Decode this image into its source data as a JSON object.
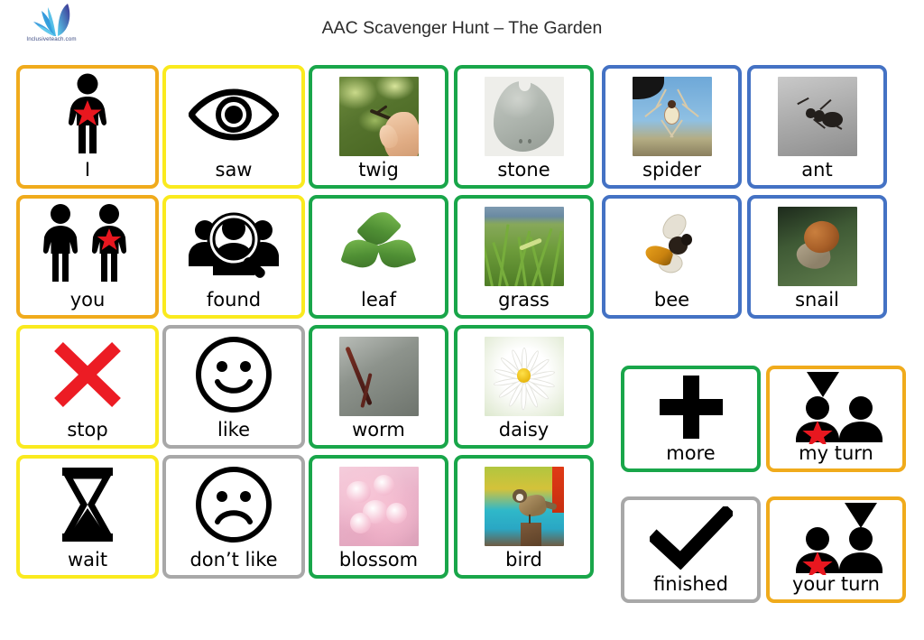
{
  "header": {
    "title": "AAC Scavenger Hunt – The Garden",
    "logo_text": "Inclusiveteach.com",
    "logo_name": "inclusiveteach-logo"
  },
  "colors": {
    "orange": "#F0AB1C",
    "yellow": "#FAEA1E",
    "green": "#19A64A",
    "blue": "#4472C4",
    "gray": "#A8A8A8",
    "star_red": "#E8171F",
    "stop_red": "#EC1C24",
    "background": "#FFFFFF",
    "title_text": "#2B2B2B"
  },
  "board": {
    "columns": 6,
    "rows": 4,
    "cards": [
      {
        "id": "i",
        "label": "I",
        "border": "orange",
        "art": "person-star-icon",
        "row": 1,
        "col": 1
      },
      {
        "id": "saw",
        "label": "saw",
        "border": "yellow",
        "art": "eye-icon",
        "row": 1,
        "col": 2
      },
      {
        "id": "twig",
        "label": "twig",
        "border": "green",
        "art": "twig-photo",
        "row": 1,
        "col": 3
      },
      {
        "id": "stone",
        "label": "stone",
        "border": "green",
        "art": "stone-photo",
        "row": 1,
        "col": 4
      },
      {
        "id": "spider",
        "label": "spider",
        "border": "blue",
        "art": "spider-photo",
        "row": 1,
        "col": 5
      },
      {
        "id": "ant",
        "label": "ant",
        "border": "blue",
        "art": "ant-photo",
        "row": 1,
        "col": 6
      },
      {
        "id": "you",
        "label": "you",
        "border": "orange",
        "art": "two-people-star-icon",
        "row": 2,
        "col": 1
      },
      {
        "id": "found",
        "label": "found",
        "border": "yellow",
        "art": "magnifier-people-icon",
        "row": 2,
        "col": 2
      },
      {
        "id": "leaf",
        "label": "leaf",
        "border": "green",
        "art": "leaf-photo",
        "row": 2,
        "col": 3
      },
      {
        "id": "grass",
        "label": "grass",
        "border": "green",
        "art": "grass-photo",
        "row": 2,
        "col": 4
      },
      {
        "id": "bee",
        "label": "bee",
        "border": "blue",
        "art": "bee-photo",
        "row": 2,
        "col": 5
      },
      {
        "id": "snail",
        "label": "snail",
        "border": "blue",
        "art": "snail-photo",
        "row": 2,
        "col": 6
      },
      {
        "id": "stop",
        "label": "stop",
        "border": "yellow",
        "art": "red-cross-icon",
        "row": 3,
        "col": 1
      },
      {
        "id": "like",
        "label": "like",
        "border": "gray",
        "art": "happy-face-icon",
        "row": 3,
        "col": 2
      },
      {
        "id": "worm",
        "label": "worm",
        "border": "green",
        "art": "worm-photo",
        "row": 3,
        "col": 3
      },
      {
        "id": "daisy",
        "label": "daisy",
        "border": "green",
        "art": "daisy-photo",
        "row": 3,
        "col": 4
      },
      {
        "id": "wait",
        "label": "wait",
        "border": "yellow",
        "art": "hourglass-icon",
        "row": 4,
        "col": 1
      },
      {
        "id": "dont-like",
        "label": "don’t like",
        "border": "gray",
        "art": "sad-face-icon",
        "row": 4,
        "col": 2
      },
      {
        "id": "blossom",
        "label": "blossom",
        "border": "green",
        "art": "blossom-photo",
        "row": 4,
        "col": 3
      },
      {
        "id": "bird",
        "label": "bird",
        "border": "green",
        "art": "bird-photo",
        "row": 4,
        "col": 4
      },
      {
        "id": "more",
        "label": "more",
        "border": "green",
        "art": "plus-icon",
        "row": 3,
        "col": 5
      },
      {
        "id": "my-turn",
        "label": "my turn",
        "border": "orange",
        "art": "my-turn-icon",
        "row": 3,
        "col": 6
      },
      {
        "id": "finished",
        "label": "finished",
        "border": "gray",
        "art": "checkmark-icon",
        "row": 4,
        "col": 5
      },
      {
        "id": "your-turn",
        "label": "your turn",
        "border": "orange",
        "art": "your-turn-icon",
        "row": 4,
        "col": 6
      }
    ]
  }
}
